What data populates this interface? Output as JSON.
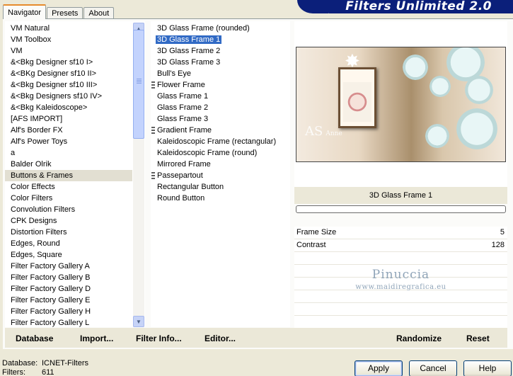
{
  "tabs": [
    "Navigator",
    "Presets",
    "About"
  ],
  "banner_title": "Filters Unlimited 2.0",
  "categories": [
    "VM Natural",
    "VM Toolbox",
    "VM",
    "&<Bkg Designer sf10 I>",
    "&<BKg Designer sf10 II>",
    "&<Bkg Designer sf10 III>",
    "&<Bkg Designers sf10 IV>",
    "&<Bkg Kaleidoscope>",
    "[AFS IMPORT]",
    "Alf's Border FX",
    "Alf's Power Toys",
    "a",
    "Balder Olrik",
    "Buttons & Frames",
    "Color Effects",
    "Color Filters",
    "Convolution Filters",
    "CPK Designs",
    "Distortion Filters",
    "Edges, Round",
    "Edges, Square",
    "Filter Factory Gallery A",
    "Filter Factory Gallery B",
    "Filter Factory Gallery D",
    "Filter Factory Gallery E",
    "Filter Factory Gallery H",
    "Filter Factory Gallery L"
  ],
  "selected_category": "Buttons & Frames",
  "filters": [
    {
      "label": "3D Glass Frame (rounded)",
      "marker": false
    },
    {
      "label": "3D Glass Frame 1",
      "marker": false
    },
    {
      "label": "3D Glass Frame 2",
      "marker": false
    },
    {
      "label": "3D Glass Frame 3",
      "marker": false
    },
    {
      "label": "Bull's Eye",
      "marker": false
    },
    {
      "label": "Flower Frame",
      "marker": true
    },
    {
      "label": "Glass Frame 1",
      "marker": false
    },
    {
      "label": "Glass Frame 2",
      "marker": false
    },
    {
      "label": "Glass Frame 3",
      "marker": false
    },
    {
      "label": "Gradient Frame",
      "marker": true
    },
    {
      "label": "Kaleidoscopic Frame (rectangular)",
      "marker": false
    },
    {
      "label": "Kaleidoscopic Frame (round)",
      "marker": false
    },
    {
      "label": "Mirrored Frame",
      "marker": false
    },
    {
      "label": "Passepartout",
      "marker": true
    },
    {
      "label": "Rectangular Button",
      "marker": false
    },
    {
      "label": "Round Button",
      "marker": false
    }
  ],
  "selected_filter": "3D Glass Frame 1",
  "preview": {
    "filter_name": "3D Glass Frame 1",
    "signature": "A",
    "signature_sub": "S",
    "signature_text_1": "Anne",
    "signature_text_2": "Sophie"
  },
  "params": [
    {
      "label": "Frame Size",
      "value": "5"
    },
    {
      "label": "Contrast",
      "value": "128"
    }
  ],
  "watermark": {
    "line1": "Pinuccia",
    "line2": "www.maidiregrafica.eu"
  },
  "bottom_buttons": {
    "database": "Database",
    "import": "Import...",
    "filter_info": "Filter Info...",
    "editor": "Editor...",
    "randomize": "Randomize",
    "reset": "Reset"
  },
  "status": {
    "database_label": "Database:",
    "database_value": "ICNET-Filters",
    "filters_label": "Filters:",
    "filters_value": "611"
  },
  "dialog_buttons": {
    "apply": "Apply",
    "cancel": "Cancel",
    "help": "Help"
  },
  "colors": {
    "banner": "#0b1f7a",
    "selection": "#316ac5",
    "tab_accent": "#e68b2c",
    "face": "#ece9d8"
  }
}
